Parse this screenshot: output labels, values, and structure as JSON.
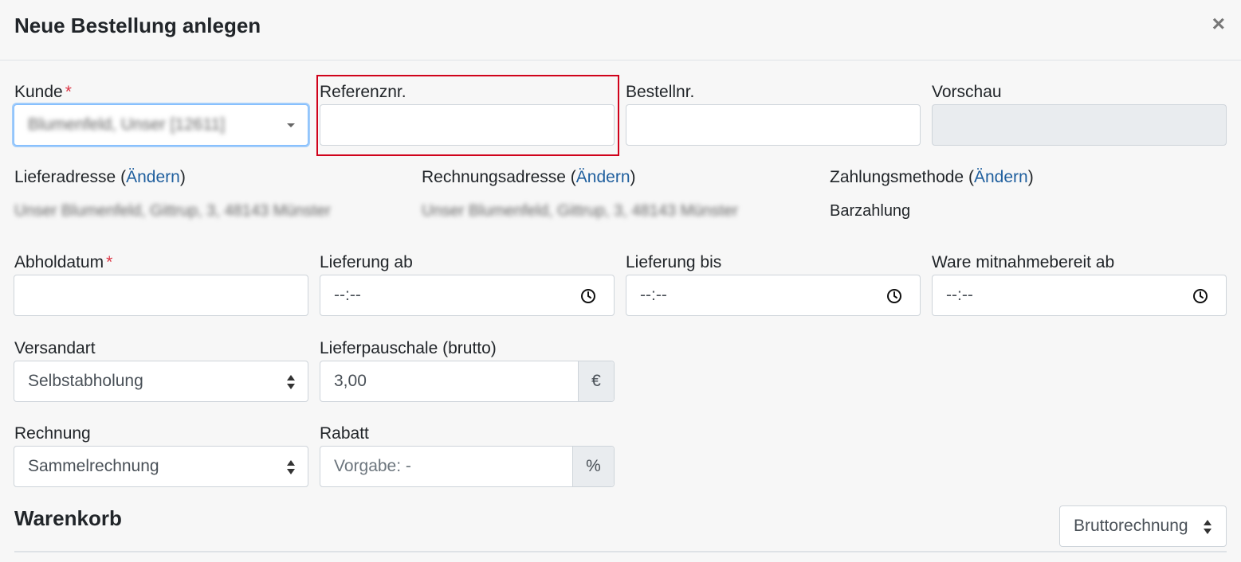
{
  "modal": {
    "title": "Neue Bestellung anlegen",
    "close_icon": "×"
  },
  "customer": {
    "label": "Kunde",
    "required": "*",
    "value": "Blumenfeld, Unser [12611]"
  },
  "reference": {
    "label": "Referenznr.",
    "value": ""
  },
  "order_no": {
    "label": "Bestellnr.",
    "value": ""
  },
  "preview": {
    "label": "Vorschau",
    "value": ""
  },
  "delivery_address": {
    "label": "Lieferadresse",
    "paren_open": "(",
    "change": "Ändern",
    "paren_close": ")",
    "value": "Unser Blumenfeld, Gittrup, 3, 48143 Münster"
  },
  "billing_address": {
    "label": "Rechnungsadresse",
    "paren_open": "(",
    "change": "Ändern",
    "paren_close": ")",
    "value": "Unser Blumenfeld, Gittrup, 3, 48143 Münster"
  },
  "payment": {
    "label": "Zahlungsmethode",
    "paren_open": "(",
    "change": "Ändern",
    "paren_close": ")",
    "value": "Barzahlung"
  },
  "pickup_date": {
    "label": "Abholdatum",
    "required": "*",
    "value": ""
  },
  "delivery_from": {
    "label": "Lieferung ab",
    "value": "--:--"
  },
  "delivery_to": {
    "label": "Lieferung bis",
    "value": "--:--"
  },
  "ready_from": {
    "label": "Ware mitnahmebereit ab",
    "value": "--:--"
  },
  "shipping": {
    "label": "Versandart",
    "value": "Selbstabholung"
  },
  "delivery_fee": {
    "label": "Lieferpauschale (brutto)",
    "value": "3,00",
    "unit": "€"
  },
  "invoice": {
    "label": "Rechnung",
    "value": "Sammelrechnung"
  },
  "discount": {
    "label": "Rabatt",
    "placeholder": "Vorgabe: -",
    "unit": "%"
  },
  "cart": {
    "title": "Warenkorb",
    "calc_mode": "Bruttorechnung"
  },
  "colors": {
    "accent_link": "#1f5f9e",
    "required": "#dc3545",
    "highlight": "#d0021b"
  }
}
